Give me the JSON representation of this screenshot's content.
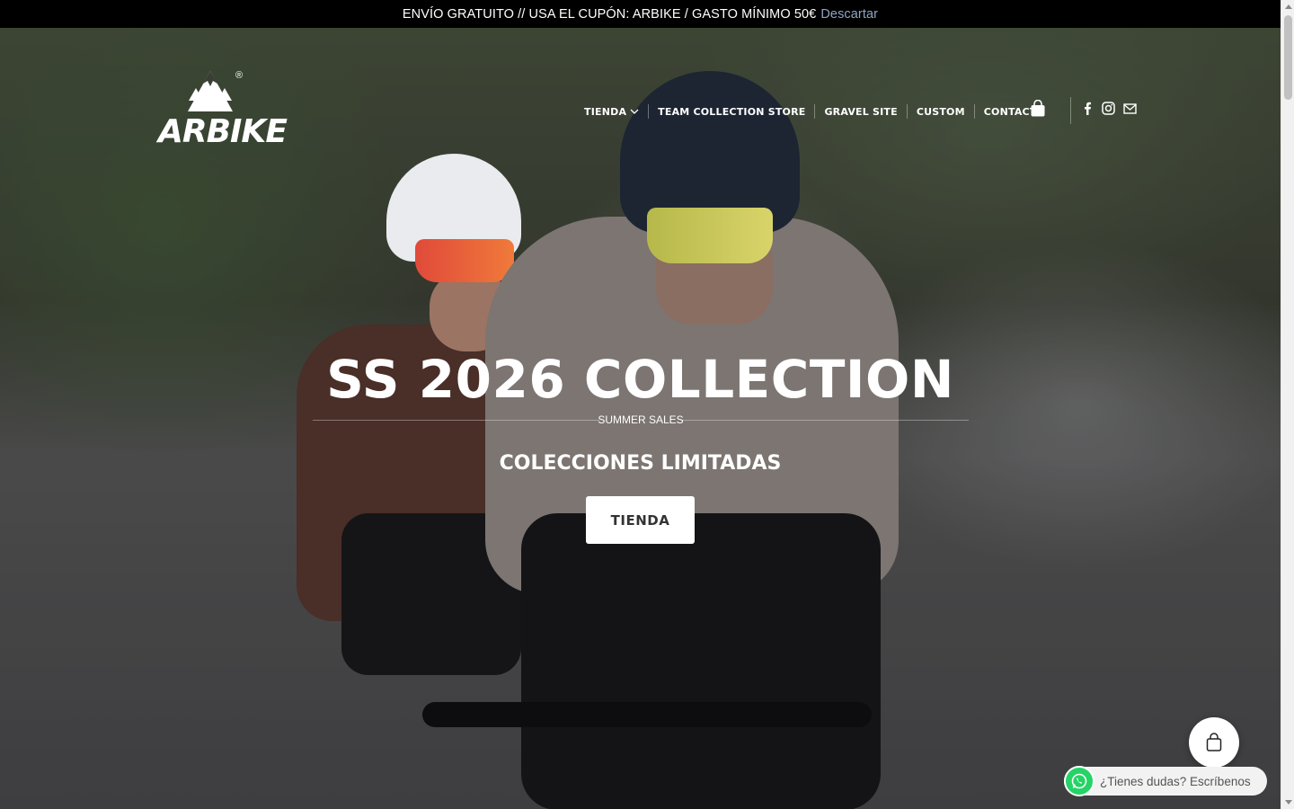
{
  "announcement": {
    "message": "ENVÍO GRATUITO // USA EL CUPÓN: ARBIKE / GASTO MÍNIMO 50€",
    "dismiss_label": "Descartar"
  },
  "brand": {
    "name": "ARBIKE",
    "registered_mark": "®"
  },
  "nav": {
    "items": [
      {
        "label": "TIENDA",
        "has_dropdown": true
      },
      {
        "label": "TEAM COLLECTION STORE"
      },
      {
        "label": "GRAVEL SITE"
      },
      {
        "label": "CUSTOM"
      },
      {
        "label": "CONTACTO"
      }
    ]
  },
  "header_icons": {
    "cart": "shopping-bag-icon",
    "social": [
      "facebook-icon",
      "instagram-icon",
      "email-icon"
    ]
  },
  "hero": {
    "title": "SS 2026 COLLECTION",
    "kicker": "SUMMER SALES",
    "subtitle": "COLECCIONES LIMITADAS",
    "cta_label": "TIENDA"
  },
  "floating": {
    "cart_icon": "shopping-bag-icon",
    "whatsapp_label": "¿Tienes dudas? Escríbenos",
    "whatsapp_icon": "whatsapp-icon"
  },
  "colors": {
    "topbar_bg": "#000000",
    "dismiss_link": "#8fa6c4",
    "whatsapp_green": "#25d366",
    "cta_bg": "#ffffff",
    "cta_text": "#333333"
  }
}
